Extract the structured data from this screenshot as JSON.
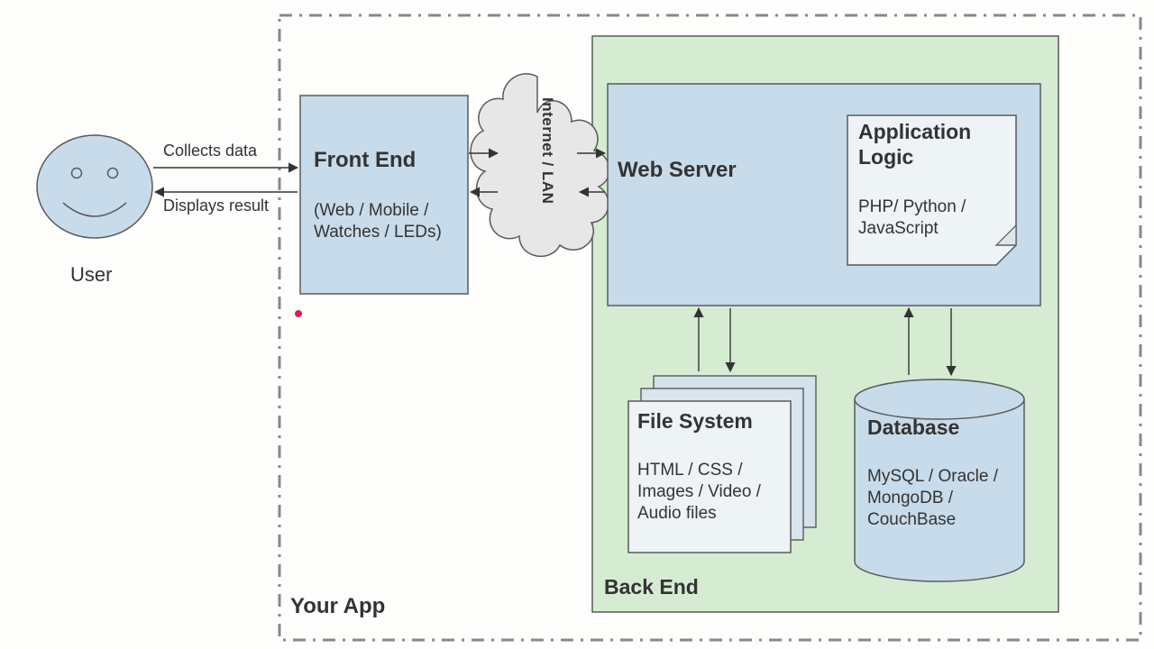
{
  "user": {
    "label": "User"
  },
  "arrows": {
    "collects": "Collects data",
    "displays": "Displays result"
  },
  "outer": {
    "label": "Your App"
  },
  "frontend": {
    "title": "Front End",
    "sub": "(Web / Mobile / Watches / LEDs)"
  },
  "cloud": {
    "label": "Internet / LAN"
  },
  "backend": {
    "label": "Back End"
  },
  "webserver": {
    "title": "Web Server"
  },
  "logic": {
    "title": "Application Logic",
    "sub": "PHP/ Python / JavaScript"
  },
  "fs": {
    "title": "File System",
    "sub": "HTML / CSS / Images / Video / Audio files"
  },
  "db": {
    "title": "Database",
    "sub": "MySQL / Oracle / MongoDB / CouchBase"
  }
}
